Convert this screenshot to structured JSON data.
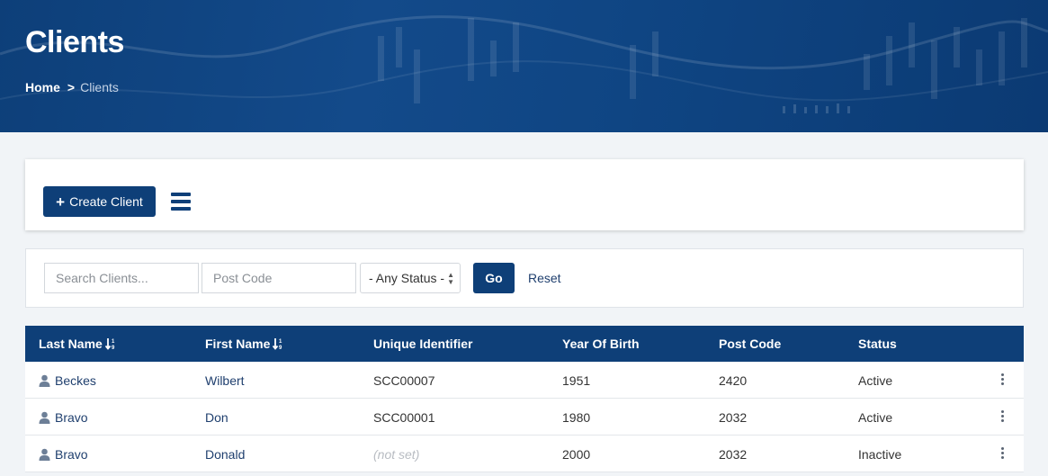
{
  "header": {
    "title": "Clients",
    "breadcrumb": {
      "home": "Home",
      "separator": ">",
      "current": "Clients"
    }
  },
  "toolbar": {
    "create_label": "Create Client",
    "create_icon": "plus-icon",
    "menu_icon": "hamburger-menu-icon"
  },
  "filters": {
    "search_placeholder": "Search Clients...",
    "postcode_placeholder": "Post Code",
    "status_selected": "- Any Status -",
    "go_label": "Go",
    "reset_label": "Reset"
  },
  "table": {
    "columns": [
      "Last Name",
      "First Name",
      "Unique Identifier",
      "Year Of Birth",
      "Post Code",
      "Status"
    ],
    "rows": [
      {
        "last_name": "Beckes",
        "first_name": "Wilbert",
        "uid": "SCC00007",
        "yob": "1951",
        "postcode": "2420",
        "status": "Active"
      },
      {
        "last_name": "Bravo",
        "first_name": "Don",
        "uid": "SCC00001",
        "yob": "1980",
        "postcode": "2032",
        "status": "Active"
      },
      {
        "last_name": "Bravo",
        "first_name": "Donald",
        "uid": "(not set)",
        "yob": "2000",
        "postcode": "2032",
        "status": "Inactive"
      }
    ]
  },
  "colors": {
    "primary": "#0e3f78",
    "link": "#1f3f6e",
    "page_bg": "#f1f4f7"
  }
}
